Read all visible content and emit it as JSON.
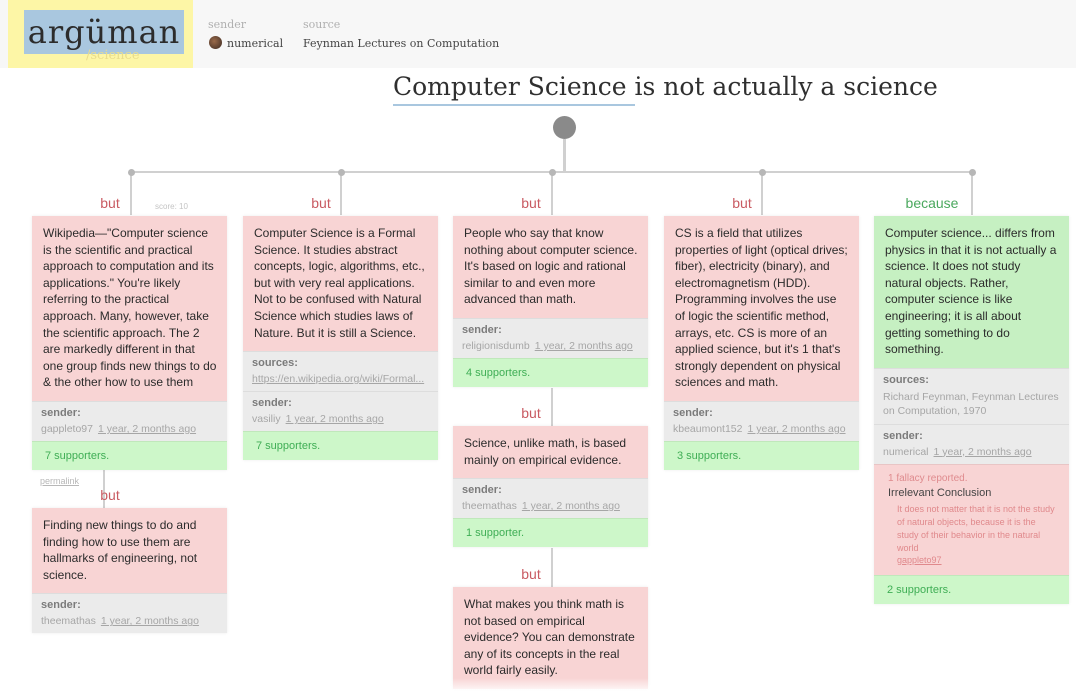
{
  "header": {
    "logo": "argüman",
    "logo_sub": "/science",
    "sender_label": "sender",
    "sender_value": "numerical",
    "source_label": "source",
    "source_value": "Feynman Lectures on Computation",
    "title": "Computer Science is not actually a science"
  },
  "colors": {
    "but": "#c95b62",
    "because": "#4aa85e",
    "objection_bg": "#f8d4d4",
    "support_bg": "#c6f0c2",
    "supporters_bg": "#cdf7c9"
  },
  "cards": {
    "c1": {
      "relation": "but",
      "score": "score: 10",
      "text": "Wikipedia—\"Computer science is the scientific and practical approach to computation and its applications.\" You're likely referring to the practical approach. Many, however, take the scientific approach. The 2 are markedly different in that one group finds new things to do & the other how to use them",
      "sender_label": "sender:",
      "sender": "gappleto97",
      "time": "1 year, 2 months ago",
      "supporters": "7 supporters.",
      "permalink": "permalink"
    },
    "c1a": {
      "relation": "but",
      "text": "Finding new things to do and finding how to use them are hallmarks of engineering, not science.",
      "sender_label": "sender:",
      "sender": "theemathas",
      "time": "1 year, 2 months ago"
    },
    "c2": {
      "relation": "but",
      "text": "Computer Science is a Formal Science. It studies abstract concepts, logic, algorithms, etc., but with very real applications. Not to be confused with Natural Science which studies laws of Nature. But it is still a Science.",
      "sources_label": "sources:",
      "sources": "https://en.wikipedia.org/wiki/Formal...",
      "sender_label": "sender:",
      "sender": "vasiliy",
      "time": "1 year, 2 months ago",
      "supporters": "7 supporters."
    },
    "c3": {
      "relation": "but",
      "text": "People who say that know nothing about computer science. It's based on logic and rational similar to and even more advanced than math.",
      "sender_label": "sender:",
      "sender": "religionisdumb",
      "time": "1 year, 2 months ago",
      "supporters": "4 supporters."
    },
    "c3a": {
      "relation": "but",
      "text": "Science, unlike math, is based mainly on empirical evidence.",
      "sender_label": "sender:",
      "sender": "theemathas",
      "time": "1 year, 2 months ago",
      "supporters": "1 supporter."
    },
    "c3b": {
      "relation": "but",
      "text": "What makes you think math is not based on empirical evidence? You can demonstrate any of its concepts in the real world fairly easily."
    },
    "c4": {
      "relation": "but",
      "text": "CS is a field that utilizes properties of light (optical drives; fiber), electricity (binary), and electromagnetism (HDD). Programming involves the use of logic the scientific method, arrays, etc. CS is more of an applied science, but it's 1 that's strongly dependent on physical sciences and math.",
      "sender_label": "sender:",
      "sender": "kbeaumont152",
      "time": "1 year, 2 months ago",
      "supporters": "3 supporters."
    },
    "c5": {
      "relation": "because",
      "text": "Computer science... differs from physics in that it is not actually a science. It does not study natural objects. Rather, computer science is like engineering; it is all about getting something to do something.",
      "sources_label": "sources:",
      "sources": "Richard Feynman, Feynman Lectures on Computation, 1970",
      "sender_label": "sender:",
      "sender": "numerical",
      "time": "1 year, 2 months ago",
      "fallacy_count": "1 fallacy reported.",
      "fallacy_name": "Irrelevant Conclusion",
      "fallacy_desc": "It does not matter that it is not the study of natural objects, because it is the study of their behavior in the natural world",
      "fallacy_user": "gappleto97",
      "supporters": "2 supporters."
    }
  }
}
